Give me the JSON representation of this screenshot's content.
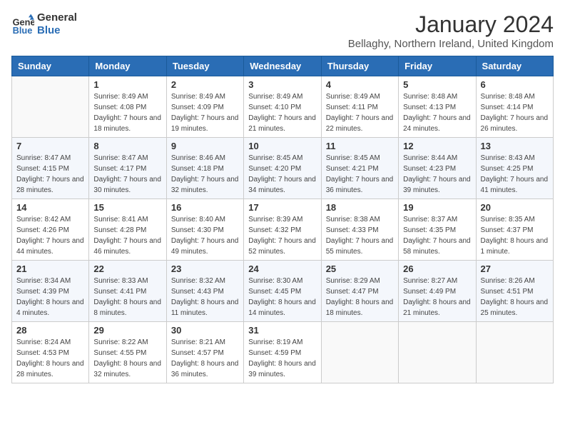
{
  "header": {
    "logo_line1": "General",
    "logo_line2": "Blue",
    "month": "January 2024",
    "location": "Bellaghy, Northern Ireland, United Kingdom"
  },
  "weekdays": [
    "Sunday",
    "Monday",
    "Tuesday",
    "Wednesday",
    "Thursday",
    "Friday",
    "Saturday"
  ],
  "weeks": [
    [
      {
        "day": "",
        "sunrise": "",
        "sunset": "",
        "daylight": ""
      },
      {
        "day": "1",
        "sunrise": "Sunrise: 8:49 AM",
        "sunset": "Sunset: 4:08 PM",
        "daylight": "Daylight: 7 hours and 18 minutes."
      },
      {
        "day": "2",
        "sunrise": "Sunrise: 8:49 AM",
        "sunset": "Sunset: 4:09 PM",
        "daylight": "Daylight: 7 hours and 19 minutes."
      },
      {
        "day": "3",
        "sunrise": "Sunrise: 8:49 AM",
        "sunset": "Sunset: 4:10 PM",
        "daylight": "Daylight: 7 hours and 21 minutes."
      },
      {
        "day": "4",
        "sunrise": "Sunrise: 8:49 AM",
        "sunset": "Sunset: 4:11 PM",
        "daylight": "Daylight: 7 hours and 22 minutes."
      },
      {
        "day": "5",
        "sunrise": "Sunrise: 8:48 AM",
        "sunset": "Sunset: 4:13 PM",
        "daylight": "Daylight: 7 hours and 24 minutes."
      },
      {
        "day": "6",
        "sunrise": "Sunrise: 8:48 AM",
        "sunset": "Sunset: 4:14 PM",
        "daylight": "Daylight: 7 hours and 26 minutes."
      }
    ],
    [
      {
        "day": "7",
        "sunrise": "Sunrise: 8:47 AM",
        "sunset": "Sunset: 4:15 PM",
        "daylight": "Daylight: 7 hours and 28 minutes."
      },
      {
        "day": "8",
        "sunrise": "Sunrise: 8:47 AM",
        "sunset": "Sunset: 4:17 PM",
        "daylight": "Daylight: 7 hours and 30 minutes."
      },
      {
        "day": "9",
        "sunrise": "Sunrise: 8:46 AM",
        "sunset": "Sunset: 4:18 PM",
        "daylight": "Daylight: 7 hours and 32 minutes."
      },
      {
        "day": "10",
        "sunrise": "Sunrise: 8:45 AM",
        "sunset": "Sunset: 4:20 PM",
        "daylight": "Daylight: 7 hours and 34 minutes."
      },
      {
        "day": "11",
        "sunrise": "Sunrise: 8:45 AM",
        "sunset": "Sunset: 4:21 PM",
        "daylight": "Daylight: 7 hours and 36 minutes."
      },
      {
        "day": "12",
        "sunrise": "Sunrise: 8:44 AM",
        "sunset": "Sunset: 4:23 PM",
        "daylight": "Daylight: 7 hours and 39 minutes."
      },
      {
        "day": "13",
        "sunrise": "Sunrise: 8:43 AM",
        "sunset": "Sunset: 4:25 PM",
        "daylight": "Daylight: 7 hours and 41 minutes."
      }
    ],
    [
      {
        "day": "14",
        "sunrise": "Sunrise: 8:42 AM",
        "sunset": "Sunset: 4:26 PM",
        "daylight": "Daylight: 7 hours and 44 minutes."
      },
      {
        "day": "15",
        "sunrise": "Sunrise: 8:41 AM",
        "sunset": "Sunset: 4:28 PM",
        "daylight": "Daylight: 7 hours and 46 minutes."
      },
      {
        "day": "16",
        "sunrise": "Sunrise: 8:40 AM",
        "sunset": "Sunset: 4:30 PM",
        "daylight": "Daylight: 7 hours and 49 minutes."
      },
      {
        "day": "17",
        "sunrise": "Sunrise: 8:39 AM",
        "sunset": "Sunset: 4:32 PM",
        "daylight": "Daylight: 7 hours and 52 minutes."
      },
      {
        "day": "18",
        "sunrise": "Sunrise: 8:38 AM",
        "sunset": "Sunset: 4:33 PM",
        "daylight": "Daylight: 7 hours and 55 minutes."
      },
      {
        "day": "19",
        "sunrise": "Sunrise: 8:37 AM",
        "sunset": "Sunset: 4:35 PM",
        "daylight": "Daylight: 7 hours and 58 minutes."
      },
      {
        "day": "20",
        "sunrise": "Sunrise: 8:35 AM",
        "sunset": "Sunset: 4:37 PM",
        "daylight": "Daylight: 8 hours and 1 minute."
      }
    ],
    [
      {
        "day": "21",
        "sunrise": "Sunrise: 8:34 AM",
        "sunset": "Sunset: 4:39 PM",
        "daylight": "Daylight: 8 hours and 4 minutes."
      },
      {
        "day": "22",
        "sunrise": "Sunrise: 8:33 AM",
        "sunset": "Sunset: 4:41 PM",
        "daylight": "Daylight: 8 hours and 8 minutes."
      },
      {
        "day": "23",
        "sunrise": "Sunrise: 8:32 AM",
        "sunset": "Sunset: 4:43 PM",
        "daylight": "Daylight: 8 hours and 11 minutes."
      },
      {
        "day": "24",
        "sunrise": "Sunrise: 8:30 AM",
        "sunset": "Sunset: 4:45 PM",
        "daylight": "Daylight: 8 hours and 14 minutes."
      },
      {
        "day": "25",
        "sunrise": "Sunrise: 8:29 AM",
        "sunset": "Sunset: 4:47 PM",
        "daylight": "Daylight: 8 hours and 18 minutes."
      },
      {
        "day": "26",
        "sunrise": "Sunrise: 8:27 AM",
        "sunset": "Sunset: 4:49 PM",
        "daylight": "Daylight: 8 hours and 21 minutes."
      },
      {
        "day": "27",
        "sunrise": "Sunrise: 8:26 AM",
        "sunset": "Sunset: 4:51 PM",
        "daylight": "Daylight: 8 hours and 25 minutes."
      }
    ],
    [
      {
        "day": "28",
        "sunrise": "Sunrise: 8:24 AM",
        "sunset": "Sunset: 4:53 PM",
        "daylight": "Daylight: 8 hours and 28 minutes."
      },
      {
        "day": "29",
        "sunrise": "Sunrise: 8:22 AM",
        "sunset": "Sunset: 4:55 PM",
        "daylight": "Daylight: 8 hours and 32 minutes."
      },
      {
        "day": "30",
        "sunrise": "Sunrise: 8:21 AM",
        "sunset": "Sunset: 4:57 PM",
        "daylight": "Daylight: 8 hours and 36 minutes."
      },
      {
        "day": "31",
        "sunrise": "Sunrise: 8:19 AM",
        "sunset": "Sunset: 4:59 PM",
        "daylight": "Daylight: 8 hours and 39 minutes."
      },
      {
        "day": "",
        "sunrise": "",
        "sunset": "",
        "daylight": ""
      },
      {
        "day": "",
        "sunrise": "",
        "sunset": "",
        "daylight": ""
      },
      {
        "day": "",
        "sunrise": "",
        "sunset": "",
        "daylight": ""
      }
    ]
  ]
}
